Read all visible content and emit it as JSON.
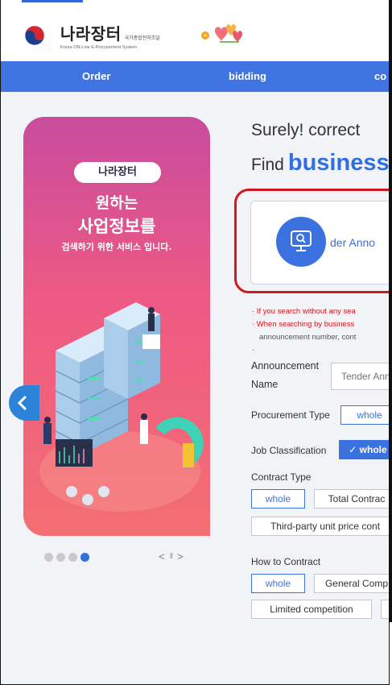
{
  "header": {
    "logo_ko": "나라장터",
    "logo_ko_small": "국가종합전자조달",
    "logo_en": "Korea ON-Line E-Procurement System"
  },
  "nav": {
    "items": [
      "Order",
      "bidding",
      "co"
    ]
  },
  "banner": {
    "pill": "나라장터",
    "line1": "원하는",
    "line2": "사업정보를",
    "line3": "검색하기 위한 서비스 입니다.",
    "dots_total": 4,
    "dots_active": 4,
    "pager_prev": "<",
    "pager_pause": "II",
    "pager_next": ">"
  },
  "search": {
    "headline1": "Surely! correct",
    "headline2_prefix": "Find",
    "headline2_highlight": "business",
    "card_label": "der Anno",
    "note1": "· If you search without any sea",
    "note2": "· When searching by business",
    "note3": "announcement number, cont",
    "note4": "·",
    "announcement_label_1": "Announcement",
    "announcement_label_2": "Name",
    "announcement_placeholder": "Tender Ann",
    "procurement_type_label": "Procurement Type",
    "procurement_type_value": "whole",
    "job_classification_label": "Job Classification",
    "job_classification_value": "✓ whole",
    "contract_type_label": "Contract Type",
    "contract_type_options": [
      "whole",
      "Total Contrac",
      "Third-party unit price cont"
    ],
    "how_to_contract_label": "How to Contract",
    "how_to_contract_options": [
      "whole",
      "General Comp",
      "Limited competition"
    ]
  },
  "colors": {
    "accent": "#3f74e2",
    "highlight_red": "#d3171e",
    "banner_pink": "#ee5a83"
  }
}
